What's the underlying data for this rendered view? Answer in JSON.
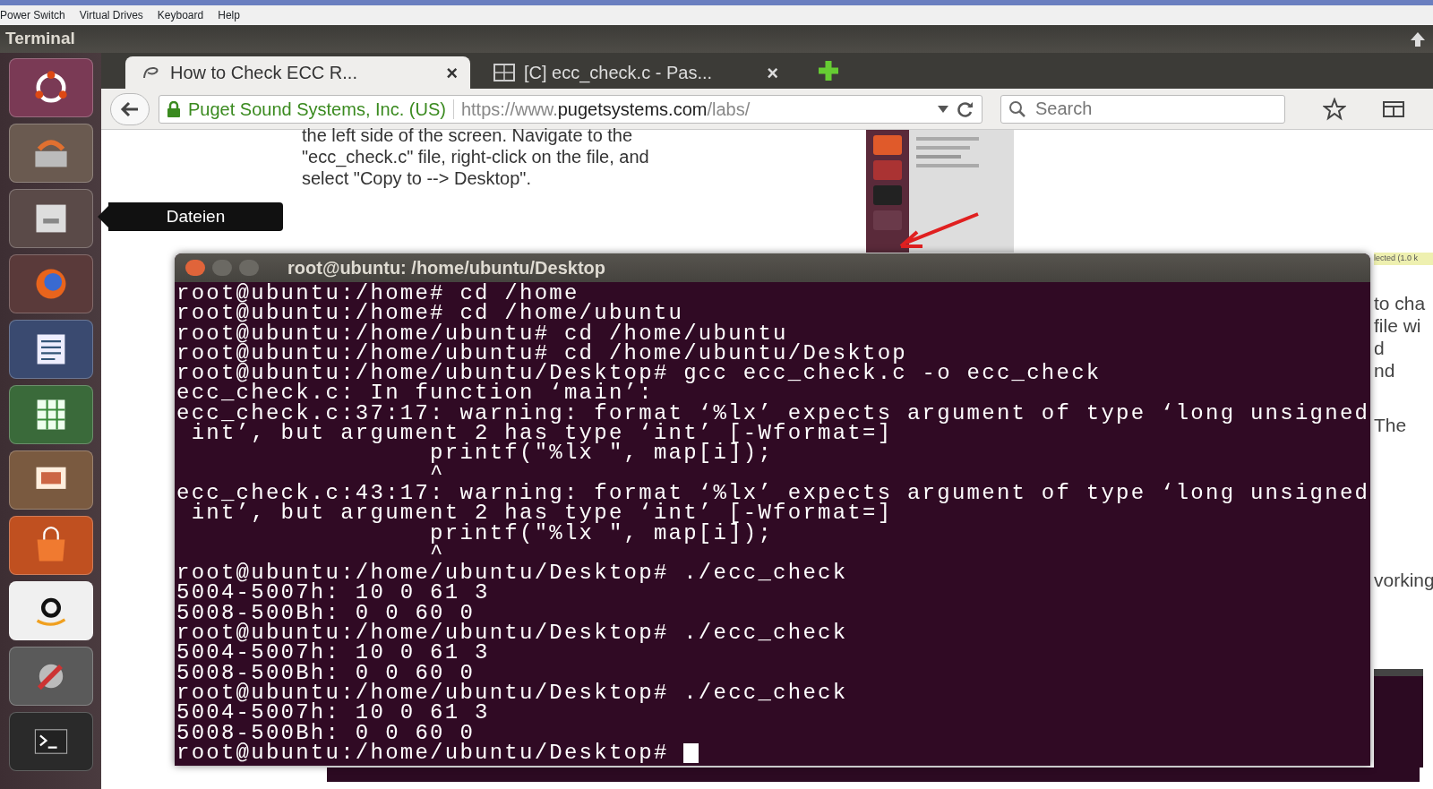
{
  "menu_bar": {
    "items": [
      "Power Switch",
      "Virtual Drives",
      "Keyboard",
      "Help"
    ]
  },
  "title_bar": {
    "title": "Terminal"
  },
  "launcher": {
    "tooltip": "Dateien"
  },
  "browser": {
    "tabs": [
      {
        "label": "How to Check ECC R...",
        "close": "×",
        "selected": true
      },
      {
        "label": "[C] ecc_check.c - Pas...",
        "close": "×",
        "selected": false
      }
    ],
    "identity": "Puget Sound Systems, Inc. (US)",
    "url": "https://www.**pugetsystems.com**/labs/",
    "search": {
      "placeholder": "Search"
    }
  },
  "page": {
    "paragraph": [
      "the left side of the screen. Navigate to the",
      "\"ecc_check.c\" file, right-click on the file, and",
      "select \"Copy to --> Desktop\"."
    ],
    "status_label": "lected (1.0 k",
    "right_fragments": [
      "to cha",
      "file wi",
      "d",
      "nd",
      "The",
      "vorking"
    ]
  },
  "terminal": {
    "title": "root@ubuntu: /home/ubuntu/Desktop",
    "cursor_visible": true,
    "lines": [
      "root@ubuntu:/home# cd /home",
      "root@ubuntu:/home# cd /home/ubuntu",
      "root@ubuntu:/home/ubuntu# cd /home/ubuntu",
      "root@ubuntu:/home/ubuntu# cd /home/ubuntu/Desktop",
      "root@ubuntu:/home/ubuntu/Desktop# gcc ecc_check.c -o ecc_check",
      "ecc_check.c: In function ‘main’:",
      "ecc_check.c:37:17: warning: format ‘%lx’ expects argument of type ‘long unsigned",
      " int’, but argument 2 has type ‘int’ [-Wformat=]",
      "                 printf(\"%lx \", map[i]);",
      "                 ^",
      "ecc_check.c:43:17: warning: format ‘%lx’ expects argument of type ‘long unsigned",
      " int’, but argument 2 has type ‘int’ [-Wformat=]",
      "                 printf(\"%lx \", map[i]);",
      "                 ^",
      "root@ubuntu:/home/ubuntu/Desktop# ./ecc_check",
      "5004-5007h: 10 0 61 3",
      "5008-500Bh: 0 0 60 0",
      "root@ubuntu:/home/ubuntu/Desktop# ./ecc_check",
      "5004-5007h: 10 0 61 3",
      "5008-500Bh: 0 0 60 0",
      "root@ubuntu:/home/ubuntu/Desktop# ./ecc_check",
      "5004-5007h: 10 0 61 3",
      "5008-500Bh: 0 0 60 0",
      "root@ubuntu:/home/ubuntu/Desktop# "
    ]
  }
}
